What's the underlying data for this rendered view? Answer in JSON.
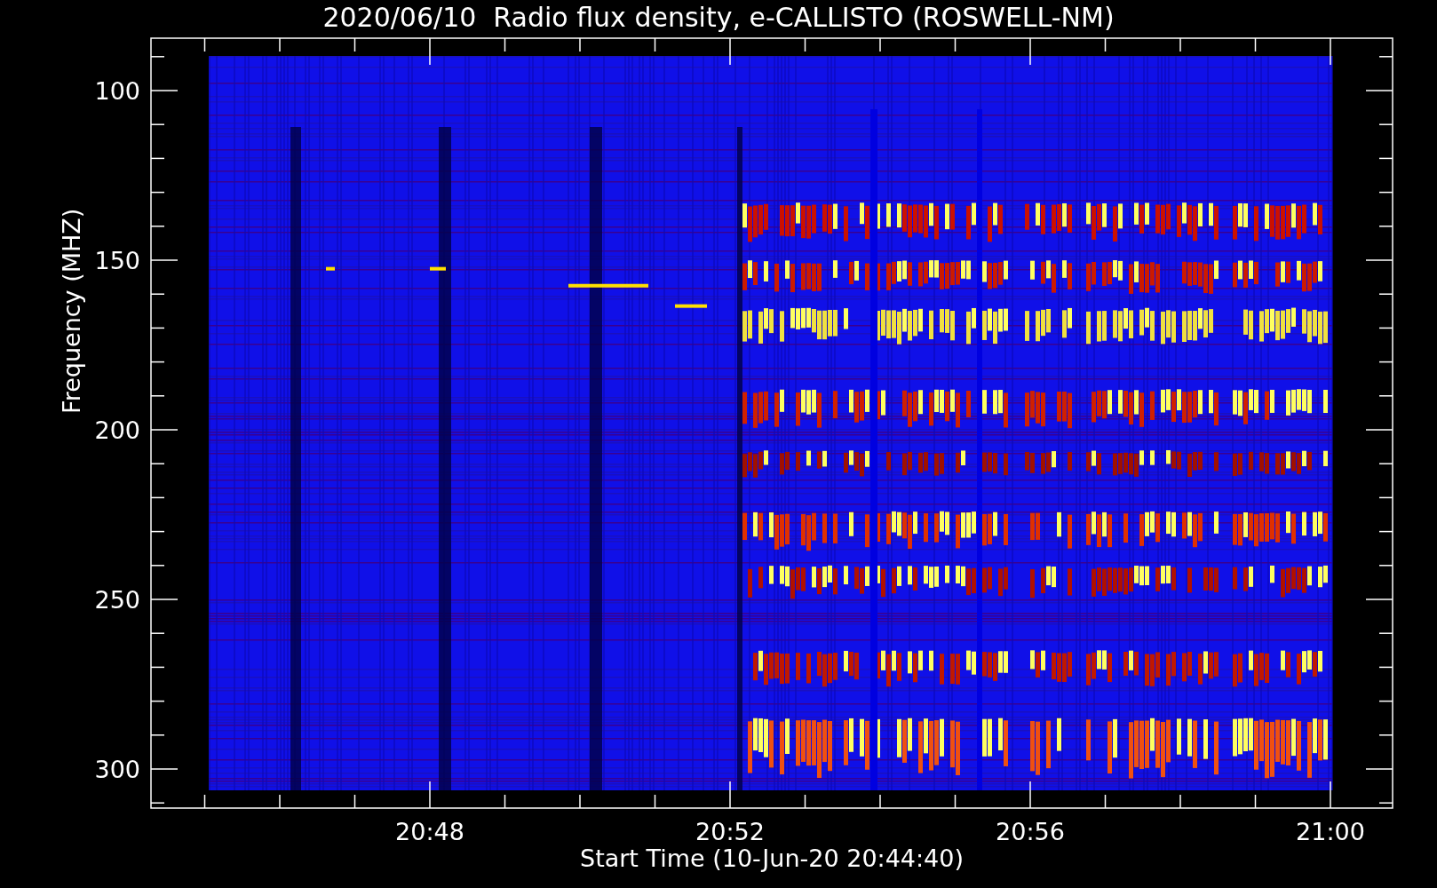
{
  "title": "2020/06/10  Radio flux density, e-CALLISTO (ROSWELL-NM)",
  "y_axis": {
    "label": "Frequency (MHZ)",
    "ticks": [
      "100",
      "150",
      "200",
      "250",
      "300"
    ]
  },
  "x_axis": {
    "label": "Start Time (10-Jun-20 20:44:40)",
    "ticks": [
      "20:48",
      "20:52",
      "20:56",
      "21:00"
    ]
  }
}
